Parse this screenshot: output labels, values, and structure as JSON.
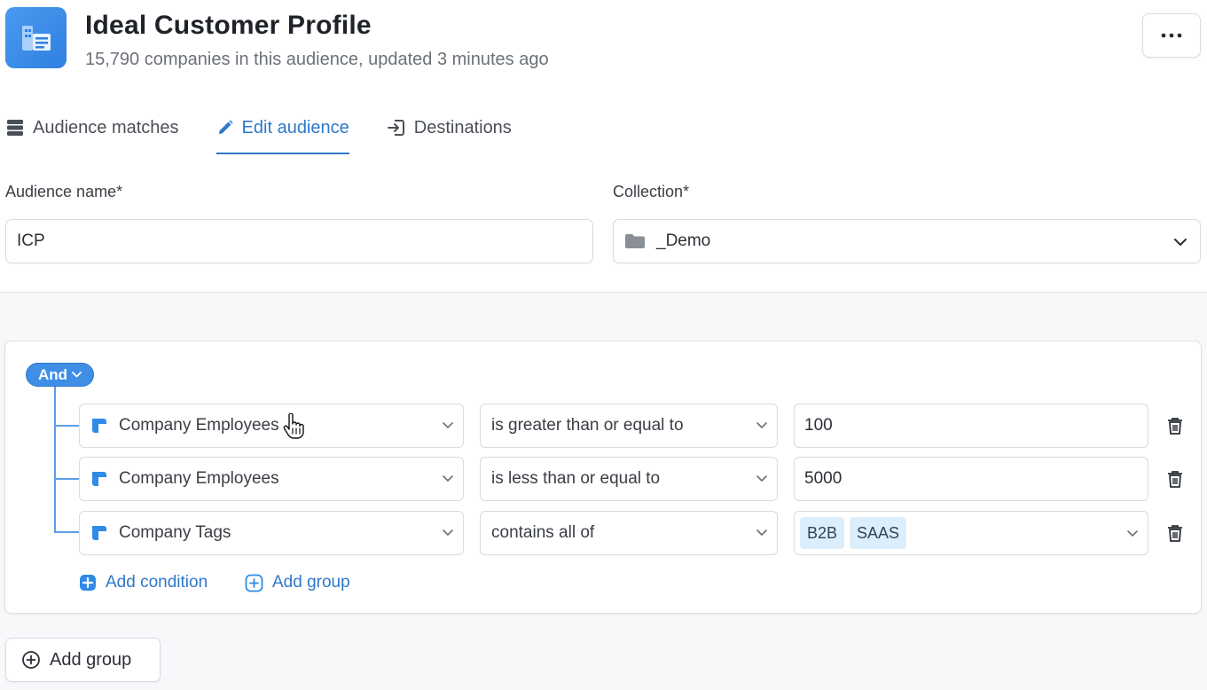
{
  "header": {
    "icon": "building-list-icon",
    "title": "Ideal Customer Profile",
    "subtitle": "15,790 companies in this audience, updated 3 minutes ago",
    "more_icon": "ellipsis-icon"
  },
  "tabs": [
    {
      "label": "Audience matches",
      "icon": "database-icon",
      "active": false
    },
    {
      "label": "Edit audience",
      "icon": "pencil-icon",
      "active": true
    },
    {
      "label": "Destinations",
      "icon": "export-arrow-icon",
      "active": false
    }
  ],
  "form": {
    "audience_name_label": "Audience name*",
    "audience_name_value": "ICP",
    "collection_label": "Collection*",
    "collection_value": "_Demo",
    "collection_icon": "folder-icon"
  },
  "builder": {
    "operator": "And",
    "conditions": [
      {
        "field": "Company Employees",
        "comparator": "is greater than or equal to",
        "value": "100"
      },
      {
        "field": "Company Employees",
        "comparator": "is less than or equal to",
        "value": "5000"
      },
      {
        "field": "Company Tags",
        "comparator": "contains all of",
        "tags": [
          "B2B",
          "SAAS"
        ]
      }
    ],
    "add_condition_label": "Add condition",
    "add_group_inner_label": "Add group"
  },
  "footer": {
    "add_group_label": "Add group"
  },
  "colors": {
    "accent": "#2f78c9",
    "operator_pill": "#3f8fe6",
    "tag_chip_bg": "#dceefb",
    "app_icon": "#3a8aea"
  }
}
